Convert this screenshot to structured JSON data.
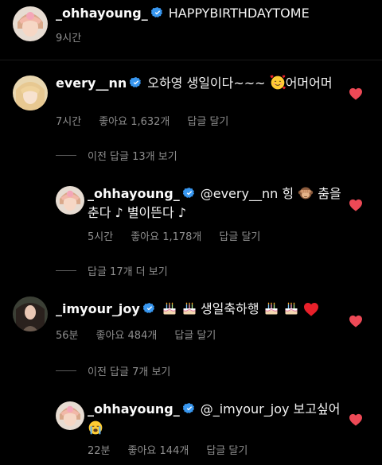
{
  "caption": {
    "username": "_ohhayoung_",
    "text": "HAPPYBIRTHDAYTOME",
    "time": "9시간"
  },
  "comments": [
    {
      "username": "every__nn",
      "text_a": "오하영 생일이다~~~",
      "text_b": "어머어머",
      "time": "7시간",
      "likes": "좋아요 1,632개",
      "reply": "답글 달기",
      "emoji": "smiling-face-with-hearts"
    },
    {
      "username": "_imyour_joy",
      "text": "생일축하행",
      "time": "56분",
      "likes": "좋아요 484개",
      "reply": "답글 달기",
      "emoji": [
        "birthday-cake",
        "birthday-cake",
        "birthday-cake",
        "birthday-cake",
        "red-heart"
      ]
    }
  ],
  "replies": [
    {
      "username": "_ohhayoung_",
      "mention": "@every__nn",
      "text_a": "힝",
      "text_b": "춤을춘다 ♪ 별이뜬다 ♪",
      "time": "5시간",
      "likes": "좋아요 1,178개",
      "reply": "답글 달기",
      "emoji": "see-no-evil-monkey"
    },
    {
      "username": "_ohhayoung_",
      "mention": "@_imyour_joy",
      "text_a": "보고싶어",
      "time": "22분",
      "likes": "좋아요 144개",
      "reply": "답글 달기",
      "emoji": "loudly-crying-face"
    }
  ],
  "view_more": {
    "prev_13": "이전 답글 13개 보기",
    "more_17": "답글 17개 더 보기",
    "prev_7": "이전 답글 7개 보기"
  },
  "colors": {
    "background": "#000000",
    "heart": "#ed4956",
    "verified": "#3897f0",
    "meta": "#8e8e8e"
  }
}
